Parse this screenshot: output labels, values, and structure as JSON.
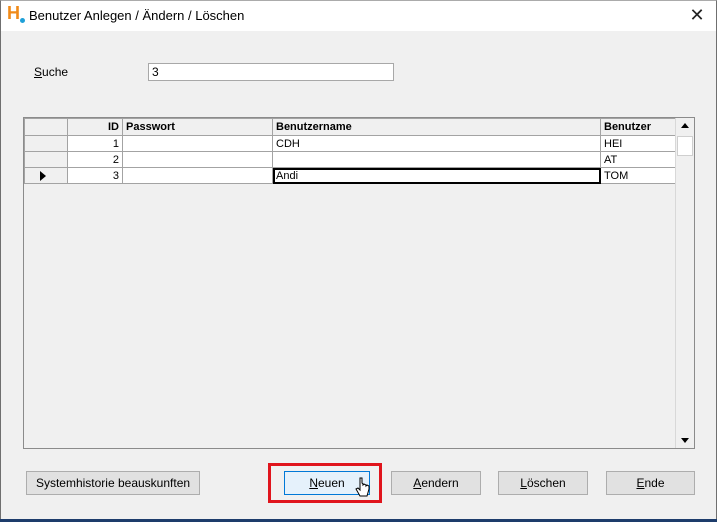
{
  "window": {
    "title": "Benutzer Anlegen / Ändern / Löschen",
    "close_glyph": "✕"
  },
  "search": {
    "label_first": "S",
    "label_rest": "uche",
    "value": "3"
  },
  "grid": {
    "columns": [
      "ID",
      "Passwort",
      "Benutzername",
      "Benutzer"
    ],
    "rows": [
      {
        "id": "1",
        "passwort": "",
        "name": "CDH",
        "benutzer": "HEI",
        "current": false
      },
      {
        "id": "2",
        "passwort": "",
        "name": "",
        "benutzer": "AT",
        "current": false
      },
      {
        "id": "3",
        "passwort": "",
        "name": "Andi",
        "benutzer": "TOM",
        "current": true
      }
    ]
  },
  "buttons": {
    "history": "Systemhistorie beauskunften",
    "new_u": "N",
    "new_rest": "euen",
    "change_u": "A",
    "change_rest": "endern",
    "delete_u": "L",
    "delete_rest": "öschen",
    "end_u": "E",
    "end_rest": "nde"
  },
  "colors": {
    "highlight": "#e0141c",
    "logo_h": "#f08a18",
    "logo_dot": "#1fa0d8"
  }
}
